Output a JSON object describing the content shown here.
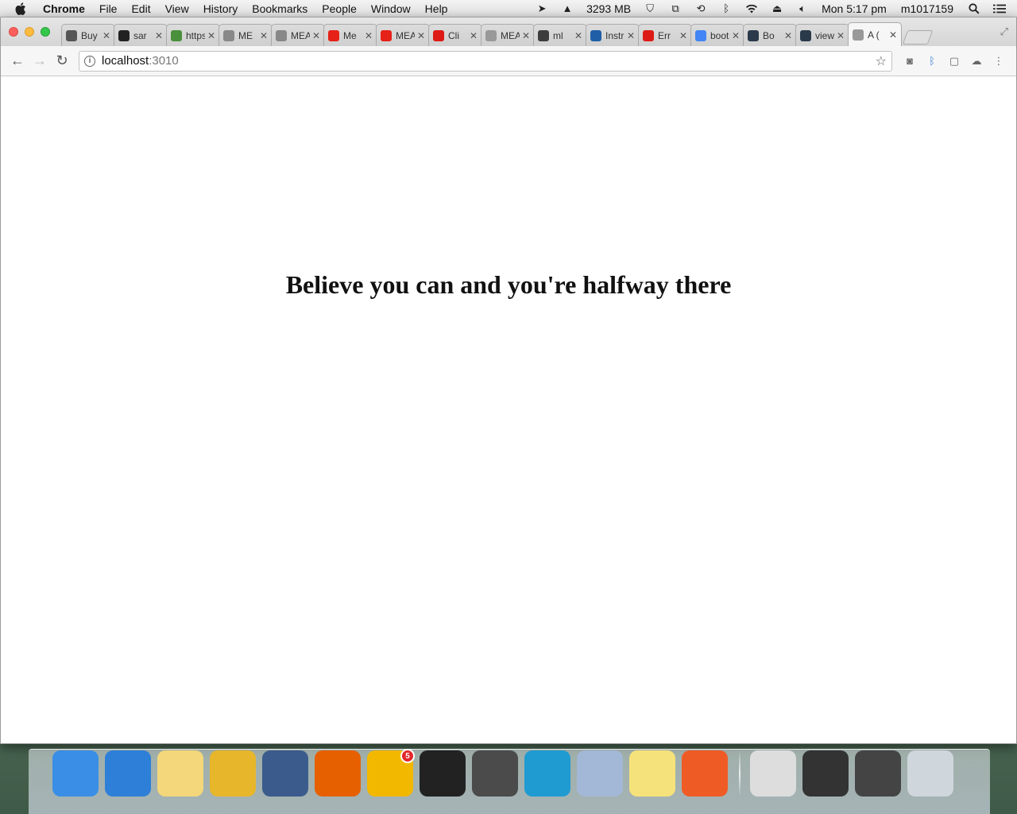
{
  "menubar": {
    "app_name": "Chrome",
    "menus": [
      "File",
      "Edit",
      "View",
      "History",
      "Bookmarks",
      "People",
      "Window",
      "Help"
    ],
    "memory": "3293 MB",
    "clock": "Mon 5:17 pm",
    "user": "m1017159"
  },
  "tabs": [
    {
      "title": "Buy B",
      "favicon": "rt-icon",
      "color": "#555555"
    },
    {
      "title": "sar",
      "favicon": "github-icon",
      "color": "#222222"
    },
    {
      "title": "https",
      "favicon": "cube-icon",
      "color": "#4a8f3c"
    },
    {
      "title": "ME",
      "favicon": "person-icon",
      "color": "#888888"
    },
    {
      "title": "MEAN",
      "favicon": "person-icon",
      "color": "#888888"
    },
    {
      "title": "Me",
      "favicon": "youtube-icon",
      "color": "#e62117"
    },
    {
      "title": "MEAN",
      "favicon": "youtube-icon",
      "color": "#e62117"
    },
    {
      "title": "Cli",
      "favicon": "angular-icon",
      "color": "#dd1b16"
    },
    {
      "title": "MEAN",
      "favicon": "document-icon",
      "color": "#999999"
    },
    {
      "title": "ml",
      "favicon": "ml-icon",
      "color": "#3c3c3c"
    },
    {
      "title": "Instru",
      "favicon": "e-icon",
      "color": "#1f5fa8"
    },
    {
      "title": "Err",
      "favicon": "angular-icon",
      "color": "#dd1b16"
    },
    {
      "title": "boot",
      "favicon": "google-icon",
      "color": "#4285f4"
    },
    {
      "title": "Bo",
      "favicon": "bootstrap-icon",
      "color": "#2b3a4a"
    },
    {
      "title": "view-",
      "favicon": "bootstrap-icon",
      "color": "#2b3a4a"
    },
    {
      "title": "A (",
      "favicon": "document-icon",
      "color": "#999999",
      "active": true
    }
  ],
  "omnibox": {
    "host": "localhost",
    "port": ":3010"
  },
  "page": {
    "headline": "Believe you can and you're halfway there"
  },
  "dock": {
    "apps": [
      {
        "name": "finder-icon",
        "color": "#3a8ee6"
      },
      {
        "name": "safari-icon",
        "color": "#2d7fd8"
      },
      {
        "name": "notes-icon",
        "color": "#f3d77a"
      },
      {
        "name": "chrome-icon",
        "color": "#e8b62a"
      },
      {
        "name": "vmware-icon",
        "color": "#3b5b8c"
      },
      {
        "name": "firefox-icon",
        "color": "#e66000"
      },
      {
        "name": "outlook-icon",
        "color": "#f2b800",
        "badge": "5"
      },
      {
        "name": "terminal-icon",
        "color": "#222222"
      },
      {
        "name": "sublime-icon",
        "color": "#4b4b4b"
      },
      {
        "name": "lync-icon",
        "color": "#1f9bd1"
      },
      {
        "name": "virtualbox-icon",
        "color": "#a3b8d6"
      },
      {
        "name": "stickies-icon",
        "color": "#f6e27a"
      },
      {
        "name": "postman-icon",
        "color": "#ef5b25"
      }
    ],
    "windows": [
      {
        "name": "minimized-window-1-icon",
        "color": "#dddddd"
      },
      {
        "name": "minimized-window-2-icon",
        "color": "#333333"
      },
      {
        "name": "minimized-window-3-icon",
        "color": "#444444"
      }
    ],
    "trash": {
      "name": "trash-icon",
      "color": "#cfd6dc"
    }
  }
}
